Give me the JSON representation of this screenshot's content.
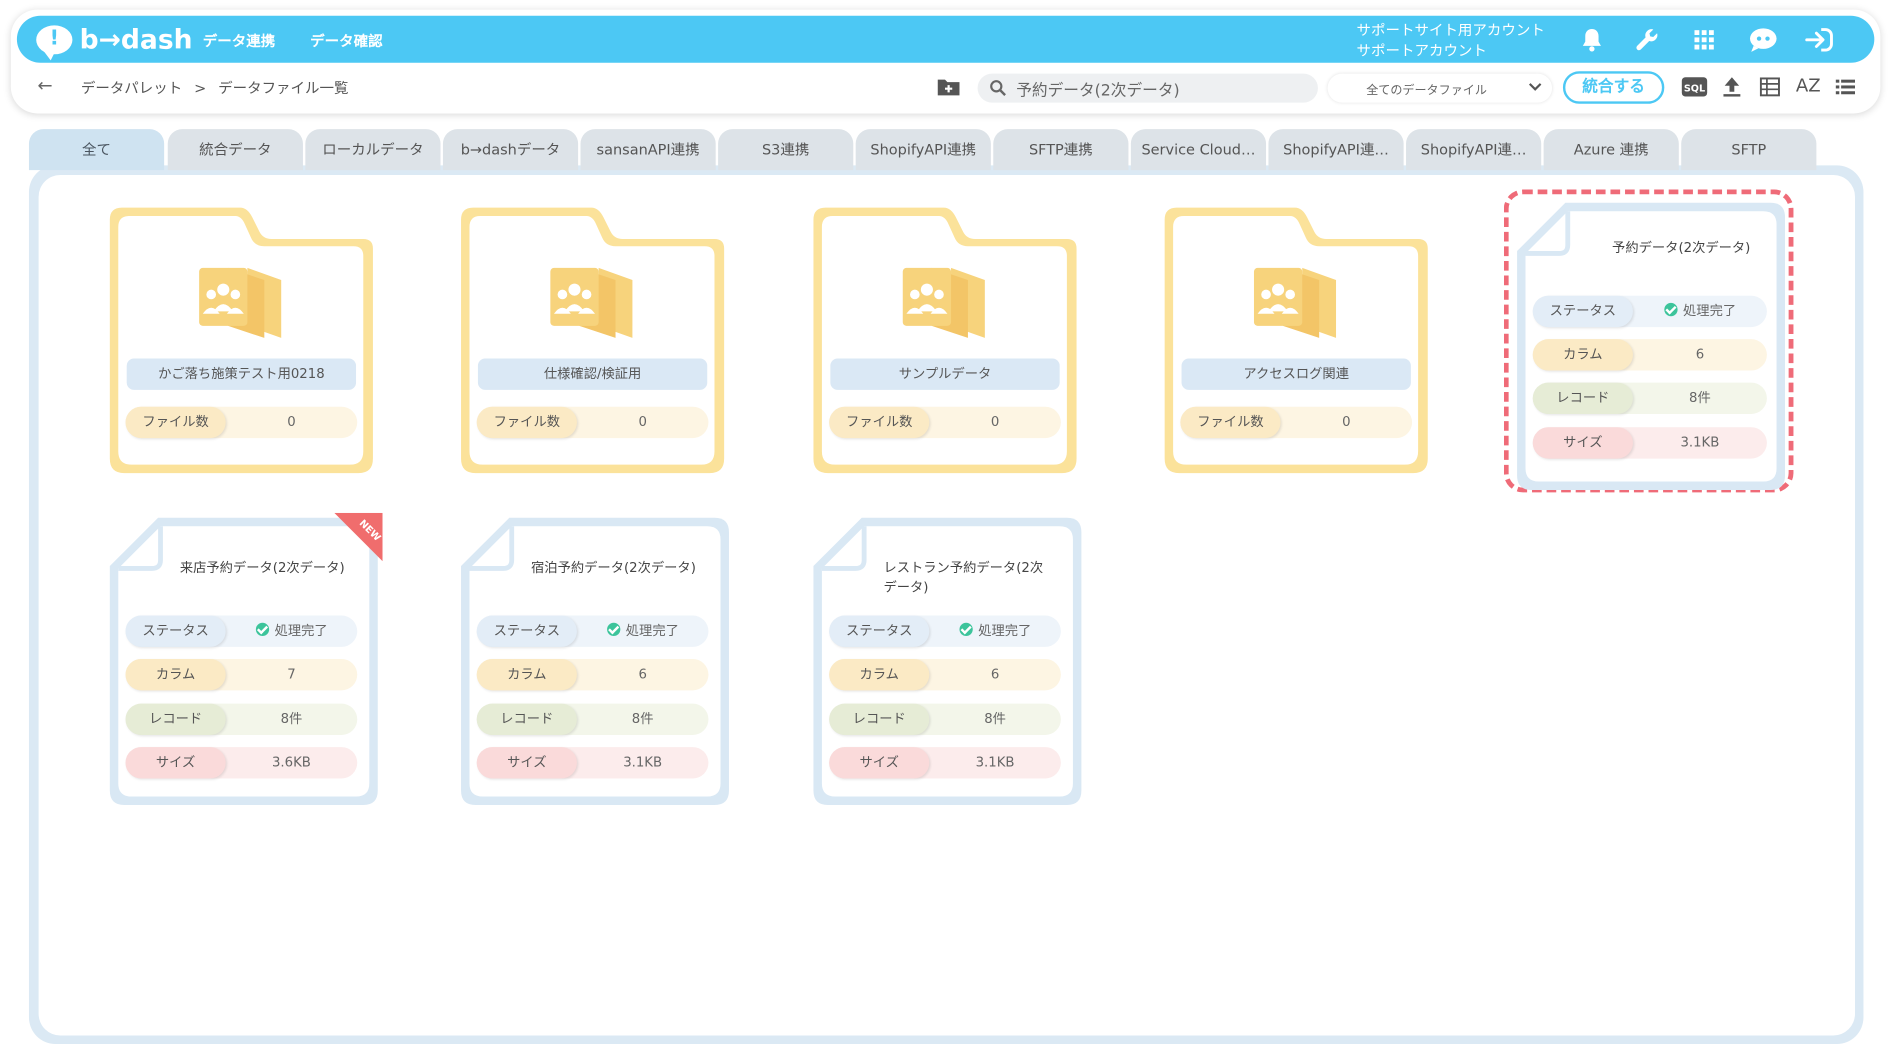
{
  "app": {
    "logo_text": "b→dash"
  },
  "header": {
    "nav": [
      "データ連携",
      "データ確認"
    ],
    "account_line1": "サポートサイト用アカウント",
    "account_line2": "サポートアカウント",
    "icons": [
      "bell-icon",
      "wrench-icon",
      "grid-apps-icon",
      "chatbot-icon",
      "logout-icon"
    ]
  },
  "breadcrumb": {
    "root": "データパレット",
    "separator": ">",
    "current": "データファイル一覧"
  },
  "toolbar": {
    "search_value": "予約データ(2次データ)",
    "filter_selected": "全てのデータファイル",
    "merge_label": "統合する",
    "sql_label": "SQL",
    "sort_label": "AZ"
  },
  "tabs": [
    "全て",
    "統合データ",
    "ローカルデータ",
    "b→dashデータ",
    "sansanAPI連携",
    "S3連携",
    "ShopifyAPI連携",
    "SFTP連携",
    "Service Cloud…",
    "ShopifyAPI連…",
    "ShopifyAPI連…",
    "Azure 連携",
    "SFTP"
  ],
  "active_tab": "全て",
  "labels": {
    "file_count": "ファイル数",
    "status": "ステータス",
    "column": "カラム",
    "record": "レコード",
    "size": "サイズ",
    "new_badge": "NEW"
  },
  "folders": [
    {
      "name": "かご落ち施策テスト用0218",
      "file_count": "0"
    },
    {
      "name": "仕様確認/検証用",
      "file_count": "0"
    },
    {
      "name": "サンプルデータ",
      "file_count": "0"
    },
    {
      "name": "アクセスログ関連",
      "file_count": "0"
    }
  ],
  "files": [
    {
      "title": "予約データ(2次データ)",
      "status": "処理完了",
      "columns": "6",
      "records": "8件",
      "size": "3.1KB",
      "highlighted": true,
      "new": false
    },
    {
      "title": "来店予約データ(2次データ)",
      "status": "処理完了",
      "columns": "7",
      "records": "8件",
      "size": "3.6KB",
      "highlighted": false,
      "new": true
    },
    {
      "title": "宿泊予約データ(2次データ)",
      "status": "処理完了",
      "columns": "6",
      "records": "8件",
      "size": "3.1KB",
      "highlighted": false,
      "new": false
    },
    {
      "title": "レストラン予約データ(2次データ)",
      "status": "処理完了",
      "columns": "6",
      "records": "8件",
      "size": "3.1KB",
      "highlighted": false,
      "new": false
    }
  ],
  "colors": {
    "brand": "#4cc8f4",
    "folder": "#fbe29a",
    "highlight": "#ef6b78",
    "status_ok": "#3cc49b"
  }
}
